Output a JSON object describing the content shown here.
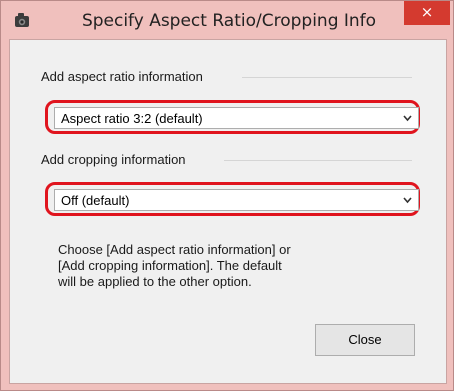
{
  "dialog": {
    "title": "Specify Aspect Ratio/Cropping Info",
    "close_glyph": "×"
  },
  "aspect_ratio": {
    "label": "Add aspect ratio information",
    "selected": "Aspect ratio 3:2 (default)"
  },
  "cropping": {
    "label": "Add cropping information",
    "selected": "Off (default)"
  },
  "description": {
    "line1": "Choose [Add aspect ratio information] or",
    "line2": "[Add cropping information]. The default",
    "line3": "will be applied to the other option."
  },
  "buttons": {
    "close_label": "Close"
  },
  "icons": {
    "app": "app-icon",
    "close": "close-icon",
    "chevron": "chevron-down-icon"
  },
  "colors": {
    "title_bar": "#f0c0bd",
    "close_button": "#d43a2f",
    "highlight_ring": "#e0141e",
    "client_bg": "#f0f0f0"
  }
}
